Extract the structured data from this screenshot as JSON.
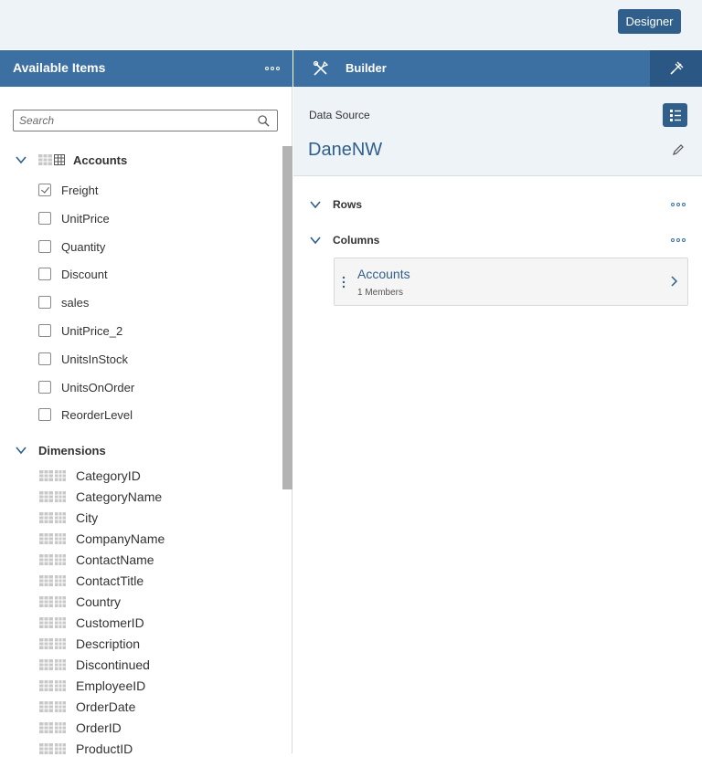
{
  "topbar": {
    "designer_label": "Designer"
  },
  "left_panel": {
    "title": "Available Items",
    "search_placeholder": "Search",
    "accounts_group": {
      "label": "Accounts",
      "items": [
        {
          "label": "Freight",
          "checked": true
        },
        {
          "label": "UnitPrice",
          "checked": false
        },
        {
          "label": "Quantity",
          "checked": false
        },
        {
          "label": "Discount",
          "checked": false
        },
        {
          "label": "sales",
          "checked": false
        },
        {
          "label": "UnitPrice_2",
          "checked": false
        },
        {
          "label": "UnitsInStock",
          "checked": false
        },
        {
          "label": "UnitsOnOrder",
          "checked": false
        },
        {
          "label": "ReorderLevel",
          "checked": false
        }
      ]
    },
    "dimensions_group": {
      "label": "Dimensions",
      "items": [
        "CategoryID",
        "CategoryName",
        "City",
        "CompanyName",
        "ContactName",
        "ContactTitle",
        "Country",
        "CustomerID",
        "Description",
        "Discontinued",
        "EmployeeID",
        "OrderDate",
        "OrderID",
        "ProductID"
      ]
    }
  },
  "right_panel": {
    "title": "Builder",
    "data_source_label": "Data Source",
    "data_source_name": "DaneNW",
    "rows_label": "Rows",
    "columns_label": "Columns",
    "column_card": {
      "title": "Accounts",
      "subtitle": "1 Members"
    }
  },
  "colors": {
    "header_bg": "#3c6fa2",
    "accent": "#2f5f8a",
    "light_bg": "#eef3f8"
  }
}
